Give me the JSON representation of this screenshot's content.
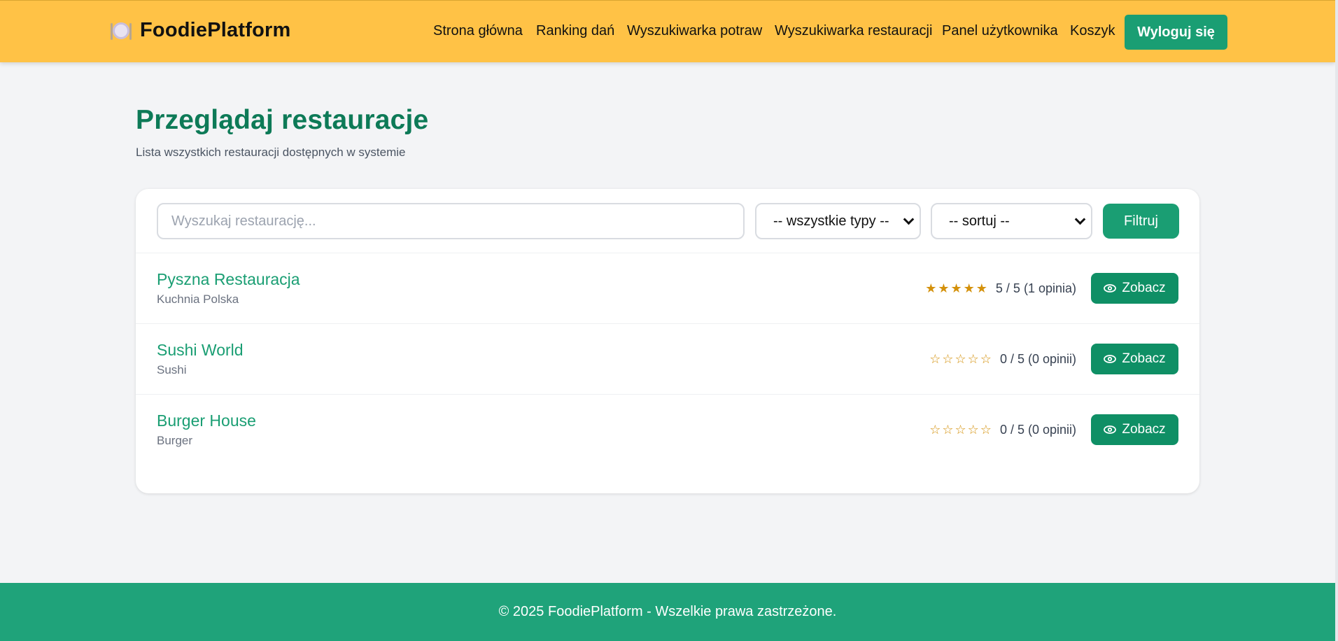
{
  "header": {
    "brand_icon": "plate-with-cutlery-icon",
    "brand_name": "FoodiePlatform",
    "nav": [
      {
        "label": "Strona główna"
      },
      {
        "label": "Ranking dań"
      },
      {
        "label": "Wyszukiwarka potraw"
      },
      {
        "label": "Wyszukiwarka restauracji"
      },
      {
        "label": "Panel użytkownika"
      },
      {
        "label": "Koszyk"
      }
    ],
    "logout_label": "Wyloguj się"
  },
  "page": {
    "title": "Przeglądaj restauracje",
    "subtitle": "Lista wszystkich restauracji dostępnych w systemie"
  },
  "filters": {
    "search_placeholder": "Wyszukaj restaurację...",
    "search_value": "",
    "type_select": "-- wszystkie typy --",
    "sort_select": "-- sortuj --",
    "filter_label": "Filtruj"
  },
  "restaurants": [
    {
      "name": "Pyszna Restauracja",
      "type": "Kuchnia Polska",
      "stars": "★★★★★",
      "rating": 5,
      "rating_text": "5 / 5 (1 opinia)",
      "view_label": "Zobacz"
    },
    {
      "name": "Sushi World",
      "type": "Sushi",
      "stars": "☆☆☆☆☆",
      "rating": 0,
      "rating_text": "0 / 5 (0 opinii)",
      "view_label": "Zobacz"
    },
    {
      "name": "Burger House",
      "type": "Burger",
      "stars": "☆☆☆☆☆",
      "rating": 0,
      "rating_text": "0 / 5 (0 opinii)",
      "view_label": "Zobacz"
    }
  ],
  "footer": {
    "text": "© 2025 FoodiePlatform - Wszelkie prawa zastrzeżone."
  },
  "colors": {
    "header_bg": "#ffc246",
    "accent": "#1a9e73",
    "title": "#0d7a57",
    "star": "#d4910b"
  }
}
